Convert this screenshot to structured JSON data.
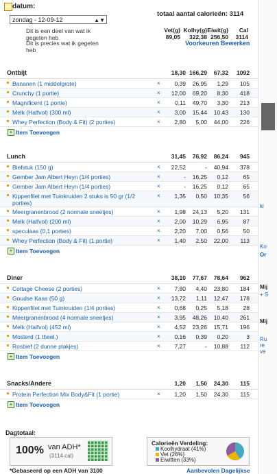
{
  "header": {
    "date_label": "datum:",
    "date_value": "zondag - 12-09-12",
    "note1": "Dit is een deel van wat ik gegeten heb",
    "note2": "Dit is precies wat ik gegeten heb",
    "total_title": "totaal aantal calorieën: 3114",
    "columns": [
      "Vet(g)",
      "Kolhy(g)",
      "Eiwit(g)",
      "Cal"
    ],
    "totals": [
      "89,05",
      "322,38",
      "256,50",
      "3114"
    ],
    "prefs_link": "Voorkeuren Bewerken"
  },
  "add_label": "Item Toevoegen",
  "sections": [
    {
      "name": "Ontbijt",
      "totals": [
        "18,30",
        "166,29",
        "67,32",
        "1092"
      ],
      "items": [
        {
          "name": "Bananen (1 middelgrote)",
          "vals": [
            "0,39",
            "26,95",
            "1,29",
            "105"
          ]
        },
        {
          "name": "Crunchy (1 portie)",
          "vals": [
            "12,00",
            "69,20",
            "8,30",
            "418"
          ]
        },
        {
          "name": "Magnificent (1 portie)",
          "vals": [
            "0,11",
            "49,70",
            "3,30",
            "213"
          ]
        },
        {
          "name": "Melk (Halfvol) (300 ml)",
          "vals": [
            "3,00",
            "15,44",
            "10,43",
            "130"
          ]
        },
        {
          "name": "Whey Perfection (Body & Fit) (2 porties)",
          "vals": [
            "2,80",
            "5,00",
            "44,00",
            "226"
          ]
        }
      ]
    },
    {
      "name": "Lunch",
      "totals": [
        "31,45",
        "76,92",
        "86,24",
        "945"
      ],
      "items": [
        {
          "name": "Biefstuk (150 g)",
          "vals": [
            "22,52",
            "-",
            "40,94",
            "378"
          ]
        },
        {
          "name": "Gember Jam Albert Heyn (1/4 porties)",
          "vals": [
            "-",
            "16,25",
            "0,12",
            "65"
          ]
        },
        {
          "name": "Gember Jam Albert Heyn (1/4 porties)",
          "vals": [
            "-",
            "16,25",
            "0,12",
            "65"
          ]
        },
        {
          "name": "Kippenfilet met Tuinkruiden 2 stuks is 50 gr (1/2 porties)",
          "vals": [
            "1,35",
            "0,50",
            "10,35",
            "56"
          ]
        },
        {
          "name": "Meergranenbrood (2 normale sneetjes)",
          "vals": [
            "1,98",
            "24,13",
            "5,20",
            "131"
          ]
        },
        {
          "name": "Melk (Halfvol) (200 ml)",
          "vals": [
            "2,00",
            "10,29",
            "6,95",
            "87"
          ]
        },
        {
          "name": "speculaas (0,1 porties)",
          "vals": [
            "2,20",
            "7,00",
            "0,56",
            "50"
          ]
        },
        {
          "name": "Whey Perfection (Body & Fit) (1 portie)",
          "vals": [
            "1,40",
            "2,50",
            "22,00",
            "113"
          ]
        }
      ]
    },
    {
      "name": "Diner",
      "totals": [
        "38,10",
        "77,67",
        "78,64",
        "962"
      ],
      "items": [
        {
          "name": "Cottage Cheese (2 porties)",
          "vals": [
            "7,80",
            "4,40",
            "23,80",
            "184"
          ]
        },
        {
          "name": "Goudse Kaas (50 g)",
          "vals": [
            "13,72",
            "1,11",
            "12,47",
            "178"
          ]
        },
        {
          "name": "Kippenfilet met Tuinkruiden (1/4 porties)",
          "vals": [
            "0,68",
            "0,25",
            "5,18",
            "28"
          ]
        },
        {
          "name": "Meergranenbrood (4 normale sneetjes)",
          "vals": [
            "3,95",
            "48,26",
            "10,40",
            "261"
          ]
        },
        {
          "name": "Melk (Halfvol) (452 ml)",
          "vals": [
            "4,52",
            "23,26",
            "15,71",
            "196"
          ]
        },
        {
          "name": "Mosterd (1 theel.)",
          "vals": [
            "0,16",
            "0,39",
            "0,20",
            "3"
          ]
        },
        {
          "name": "Rosbief (2 dunne plakjes)",
          "vals": [
            "7,27",
            "-",
            "10,88",
            "112"
          ]
        }
      ]
    },
    {
      "name": "Snacks/Andere",
      "totals": [
        "1,20",
        "1,50",
        "24,30",
        "115"
      ],
      "items": [
        {
          "name": "Protein Perfection Mix Body&Fit (1 portie)",
          "vals": [
            "1,20",
            "1,50",
            "24,30",
            "115"
          ]
        }
      ]
    }
  ],
  "summary": {
    "title": "Dagtotaal:",
    "percent": "100%",
    "adh_label": "van ADH*",
    "adh_sub": "(3114 cal)",
    "footnote": "*Gebaseerd op een ADH van 3100",
    "dist_title": "Calorieën Verdeling:",
    "dist": [
      {
        "label": "Koolhydraat (41%)",
        "color": "#49a8c0",
        "pct": 41
      },
      {
        "label": "Vet (26%)",
        "color": "#e8b400",
        "pct": 26
      },
      {
        "label": "Eiwitten (33%)",
        "color": "#8e5a9c",
        "pct": 33
      }
    ],
    "recommend_link": "Aanbevolen Dagelijkse"
  },
  "right_strip": {
    "texts": [
      "ki",
      "Ko",
      "Or",
      "Mij",
      "+ S",
      "Mij",
      "Ru",
      "re",
      "ve"
    ]
  }
}
